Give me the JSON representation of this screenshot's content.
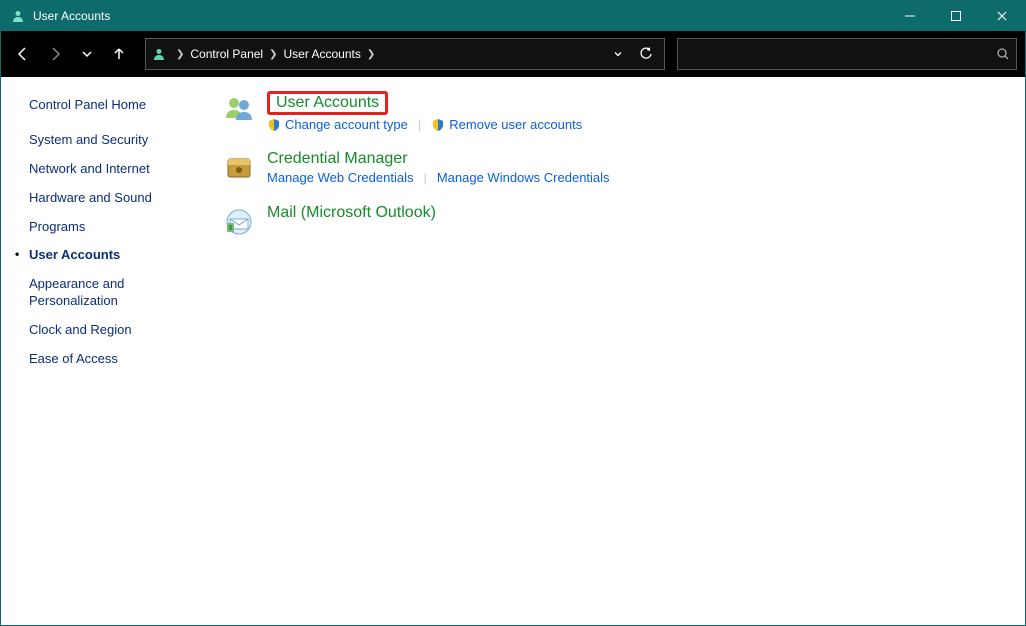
{
  "window": {
    "title": "User Accounts"
  },
  "breadcrumb": {
    "item0": "Control Panel",
    "item1": "User Accounts"
  },
  "search": {
    "placeholder": ""
  },
  "sidebar": {
    "home": "Control Panel Home",
    "items": {
      "0": "System and Security",
      "1": "Network and Internet",
      "2": "Hardware and Sound",
      "3": "Programs",
      "4": "User Accounts",
      "5": "Appearance and Personalization",
      "6": "Clock and Region",
      "7": "Ease of Access"
    }
  },
  "main": {
    "cat0": {
      "title": "User Accounts",
      "link0": "Change account type",
      "link1": "Remove user accounts"
    },
    "cat1": {
      "title": "Credential Manager",
      "link0": "Manage Web Credentials",
      "link1": "Manage Windows Credentials"
    },
    "cat2": {
      "title": "Mail (Microsoft Outlook)"
    }
  }
}
